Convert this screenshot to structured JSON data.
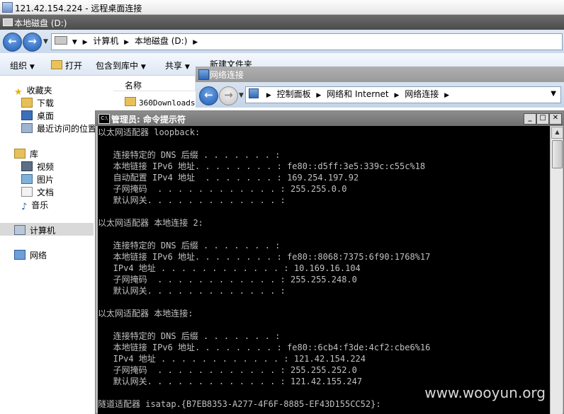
{
  "remote_desktop": {
    "title": "121.42.154.224 - 远程桌面连接"
  },
  "explorer": {
    "title": "本地磁盘 (D:)",
    "breadcrumb": [
      "计算机",
      "本地磁盘 (D:)"
    ],
    "toolbar": {
      "organize": "组织",
      "open": "打开",
      "include": "包含到库中",
      "share": "共享",
      "new_folder": "新建文件夹"
    },
    "nav": {
      "favorites": "收藏夹",
      "downloads": "下载",
      "desktop": "桌面",
      "recent": "最近访问的位置",
      "libraries": "库",
      "videos": "视频",
      "pictures": "图片",
      "documents": "文档",
      "music": "音乐",
      "computer": "计算机",
      "network": "网络"
    },
    "list": {
      "column_name": "名称",
      "items": [
        "360Downloads"
      ]
    }
  },
  "network_window": {
    "title": "网络连接",
    "breadcrumb": [
      "控制面板",
      "网络和 Internet",
      "网络连接"
    ]
  },
  "cmd": {
    "title": "管理员: 命令提示符",
    "lines": [
      "以太网适配器 loopback:",
      "",
      "   连接特定的 DNS 后缀 . . . . . . . :",
      "   本地链接 IPv6 地址. . . . . . . . : fe80::d5ff:3e5:339c:c55c%18",
      "   自动配置 IPv4 地址  . . . . . . . : 169.254.197.92",
      "   子网掩码  . . . . . . . . . . . . : 255.255.0.0",
      "   默认网关. . . . . . . . . . . . . :",
      "",
      "以太网适配器 本地连接 2:",
      "",
      "   连接特定的 DNS 后缀 . . . . . . . :",
      "   本地链接 IPv6 地址. . . . . . . . : fe80::8068:7375:6f90:1768%17",
      "   IPv4 地址 . . . . . . . . . . . . : 10.169.16.104",
      "   子网掩码  . . . . . . . . . . . . : 255.255.248.0",
      "   默认网关. . . . . . . . . . . . . :",
      "",
      "以太网适配器 本地连接:",
      "",
      "   连接特定的 DNS 后缀 . . . . . . . :",
      "   本地链接 IPv6 地址. . . . . . . . : fe80::6cb4:f3de:4cf2:cbe6%16",
      "   IPv4 地址 . . . . . . . . . . . . : 121.42.154.224",
      "   子网掩码  . . . . . . . . . . . . : 255.255.252.0",
      "   默认网关. . . . . . . . . . . . . : 121.42.155.247",
      "",
      "隧道适配器 isatap.{B7EB8353-A277-4F6F-8885-EF43D155CC52}:"
    ]
  },
  "watermark": "www.wooyun.org",
  "colors": {
    "console_bg": "#000000",
    "console_text": "#c0c0c0",
    "nav_selected": "#d9d9d9"
  }
}
